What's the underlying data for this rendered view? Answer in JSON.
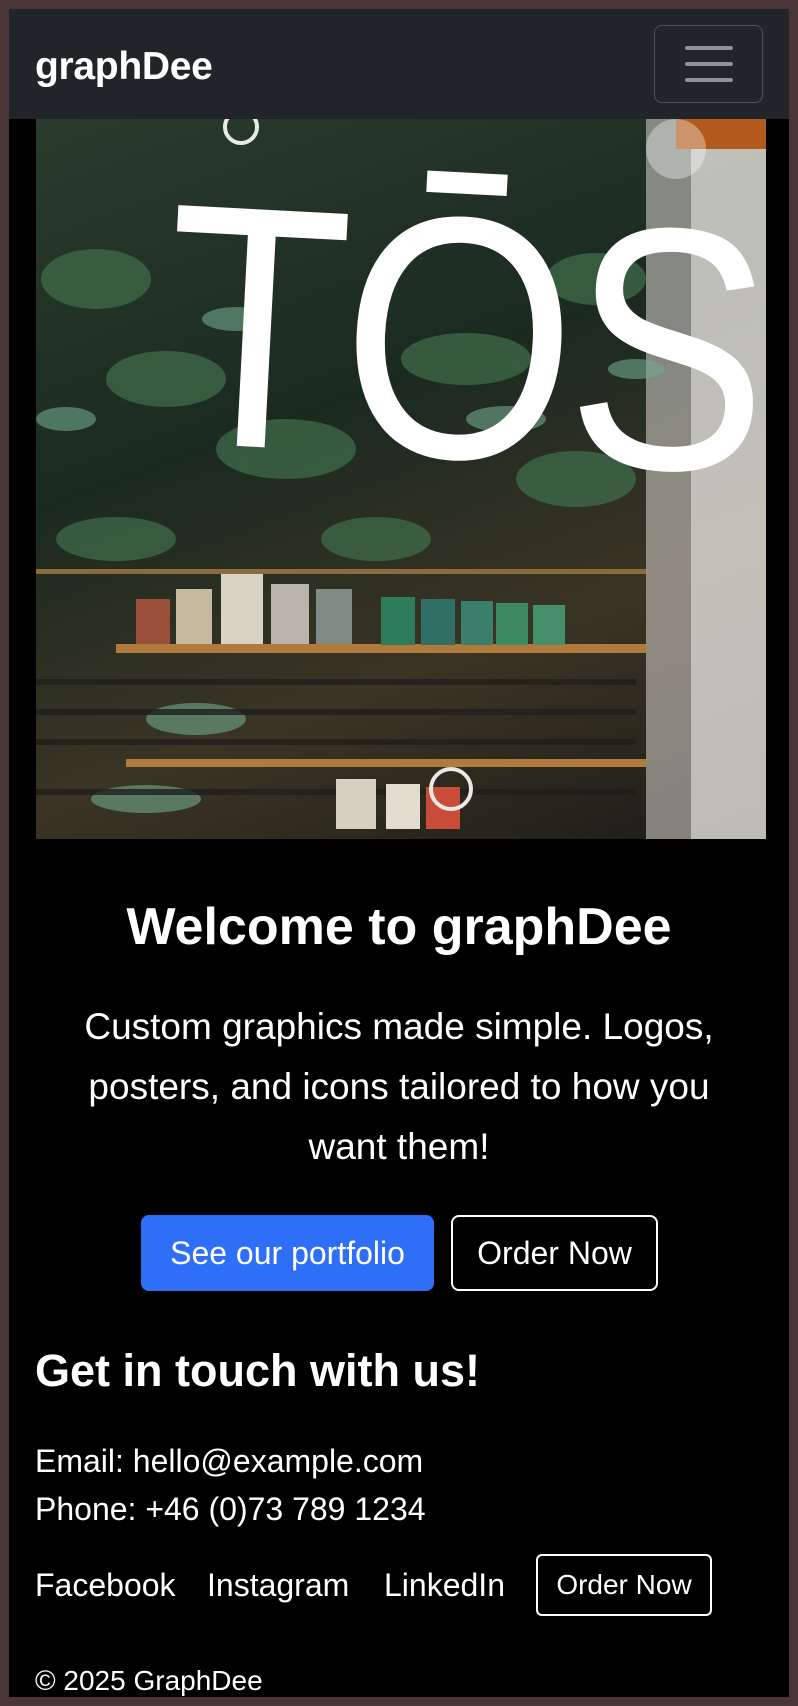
{
  "navbar": {
    "brand": "graphDee",
    "toggle_icon": "hamburger-menu-icon"
  },
  "hero": {
    "sign_text": "TŌST"
  },
  "intro": {
    "heading": "Welcome to graphDee",
    "tagline": "Custom graphics made simple. Logos, posters, and icons tailored to how you want them!",
    "primary_button": "See our portfolio",
    "secondary_button": "Order Now"
  },
  "contact": {
    "heading": "Get in touch with us!",
    "email": "Email: hello@example.com",
    "phone": "Phone: +46 (0)73 789 1234"
  },
  "footer": {
    "links": [
      "Facebook",
      "Instagram",
      "LinkedIn"
    ],
    "order_button": "Order Now",
    "copyright": "© 2025 GraphDee"
  },
  "colors": {
    "navbar_bg": "#212529",
    "page_bg": "#000000",
    "primary": "#2f6ef6"
  }
}
